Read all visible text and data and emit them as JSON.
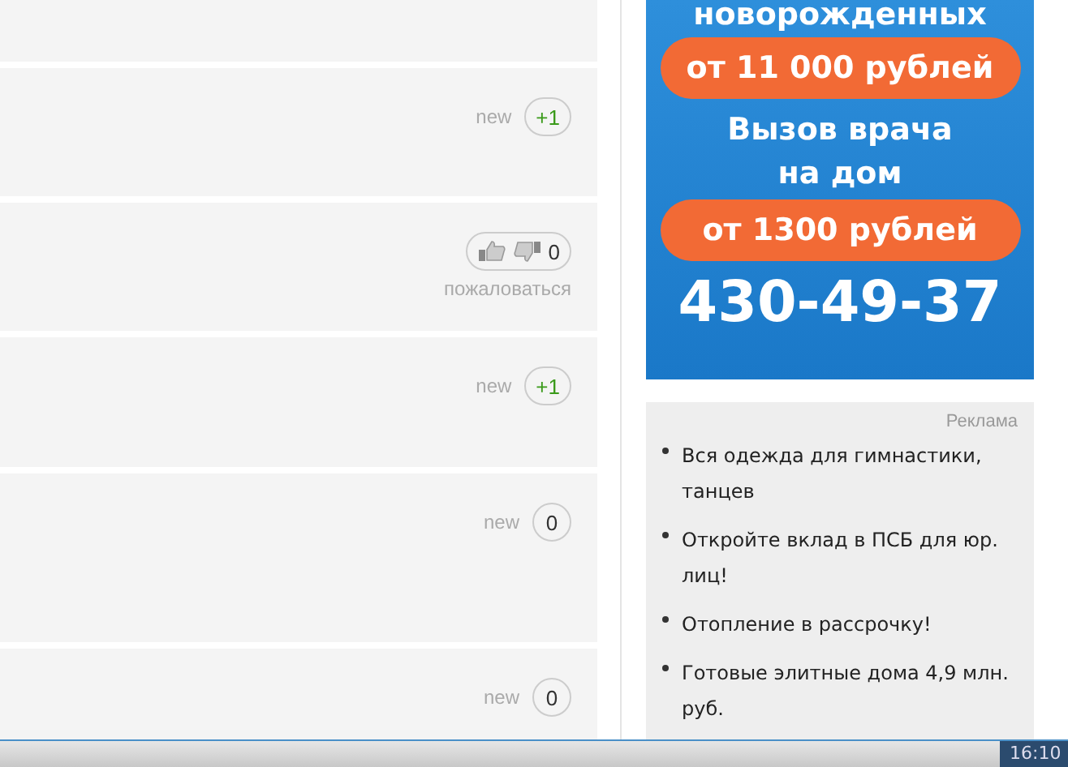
{
  "comments": [
    {
      "kind": "blank"
    },
    {
      "kind": "counter",
      "tag": "new",
      "count": "+1",
      "positive": true
    },
    {
      "kind": "votes",
      "count": "0",
      "report": "пожаловаться"
    },
    {
      "kind": "counter",
      "tag": "new",
      "count": "+1",
      "positive": true
    },
    {
      "kind": "counter",
      "tag": "new",
      "count": "0",
      "positive": false
    },
    {
      "kind": "counter",
      "tag": "new",
      "count": "0",
      "positive": false
    }
  ],
  "banner": {
    "lines": [
      {
        "kind": "heading",
        "text": "новорожденных"
      },
      {
        "kind": "price",
        "text": "от 11 000 рублей"
      },
      {
        "kind": "heading",
        "text": "Вызов врача"
      },
      {
        "kind": "heading",
        "text": "на дом"
      },
      {
        "kind": "price",
        "text": "от 1300 рублей"
      },
      {
        "kind": "phone",
        "text": "430-49-37"
      }
    ]
  },
  "ads": {
    "label": "Реклама",
    "items": [
      "Вся одежда для гимнастики, танцев",
      "Откройте вклад в ПСБ для юр. лиц!",
      "Отопление в рассрочку!",
      "Готовые элитные дома 4,9 млн. руб."
    ]
  },
  "taskbar": {
    "clock": "16:10"
  }
}
